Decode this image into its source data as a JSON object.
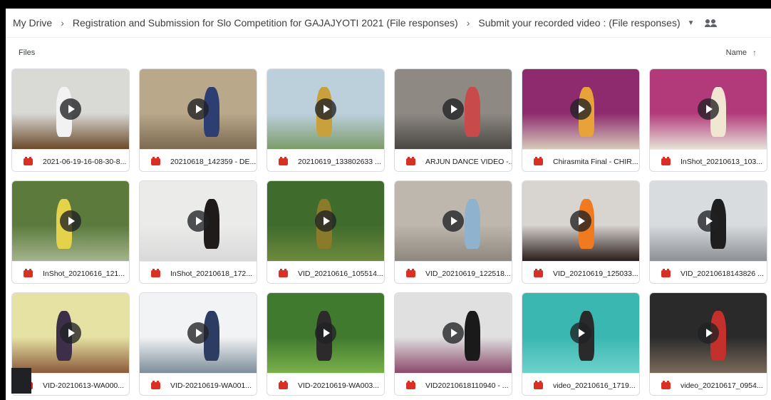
{
  "breadcrumb": {
    "root": "My Drive",
    "folder": "Registration and Submission for Slo Competition for GAJAJYOTI 2021 (File responses)",
    "current": "Submit your recorded video : (File responses)"
  },
  "list_header": {
    "section": "Files",
    "sort_label": "Name"
  },
  "icons": {
    "file": "video-file-icon",
    "play": "play-icon",
    "shared": "people-icon",
    "sort": "arrow-up-icon"
  },
  "files": [
    {
      "name": "2021-06-19-16-08-30-8...",
      "colors": [
        "#d9d9d6",
        "#6b4a2b",
        "#f2f2f2"
      ]
    },
    {
      "name": "20210618_142359 - DE...",
      "colors": [
        "#b9a88a",
        "#7d6a52",
        "#2c3e72"
      ]
    },
    {
      "name": "20210619_133802633 ...",
      "colors": [
        "#bcd0dc",
        "#7c9c6a",
        "#c9a13c"
      ]
    },
    {
      "name": "ARJUN DANCE VIDEO -...",
      "colors": [
        "#8e8a83",
        "#4a4643",
        "#c94a4a"
      ]
    },
    {
      "name": "Chirasmita Final - CHIR...",
      "colors": [
        "#8e2a6e",
        "#d6c9b9",
        "#e8a23a"
      ]
    },
    {
      "name": "InShot_20210613_103...",
      "colors": [
        "#b23a7a",
        "#e6e1d8",
        "#f0e6d2"
      ]
    },
    {
      "name": "InShot_20210616_121...",
      "colors": [
        "#5b7a3c",
        "#a4b48c",
        "#e3d24a"
      ]
    },
    {
      "name": "InShot_20210618_172...",
      "colors": [
        "#ebebea",
        "#d9d9d9",
        "#1e1b1a"
      ]
    },
    {
      "name": "VID_20210616_105514...",
      "colors": [
        "#3f6b2c",
        "#6d8a3d",
        "#8a7a2a"
      ]
    },
    {
      "name": "VID_20210619_122518...",
      "colors": [
        "#bdb7ae",
        "#8d877d",
        "#8fb3cf"
      ]
    },
    {
      "name": "VID_20210619_125033...",
      "colors": [
        "#d8d4cf",
        "#2a1d1a",
        "#f07a20"
      ]
    },
    {
      "name": "VID_20210618143826 ...",
      "colors": [
        "#d8dcdf",
        "#8c8f93",
        "#1e1e1e"
      ]
    },
    {
      "name": "VID-20210613-WA000...",
      "colors": [
        "#e6e2a3",
        "#8b5a3a",
        "#3d2f4a"
      ]
    },
    {
      "name": "VID-20210619-WA001...",
      "colors": [
        "#f2f3f4",
        "#7d8e9b",
        "#2d3c62"
      ]
    },
    {
      "name": "VID-20210619-WA003...",
      "colors": [
        "#3f7a2e",
        "#7ab04b",
        "#2c2a2a"
      ]
    },
    {
      "name": "VID20210618110940 - ...",
      "colors": [
        "#e0e0e0",
        "#8a4a6a",
        "#1a1a1a"
      ]
    },
    {
      "name": "video_20210616_1719...",
      "colors": [
        "#3ab7b1",
        "#6fd1cb",
        "#2a2a2a"
      ]
    },
    {
      "name": "video_20210617_0954...",
      "colors": [
        "#2a2a2a",
        "#7a6a5a",
        "#c4302b"
      ]
    }
  ]
}
